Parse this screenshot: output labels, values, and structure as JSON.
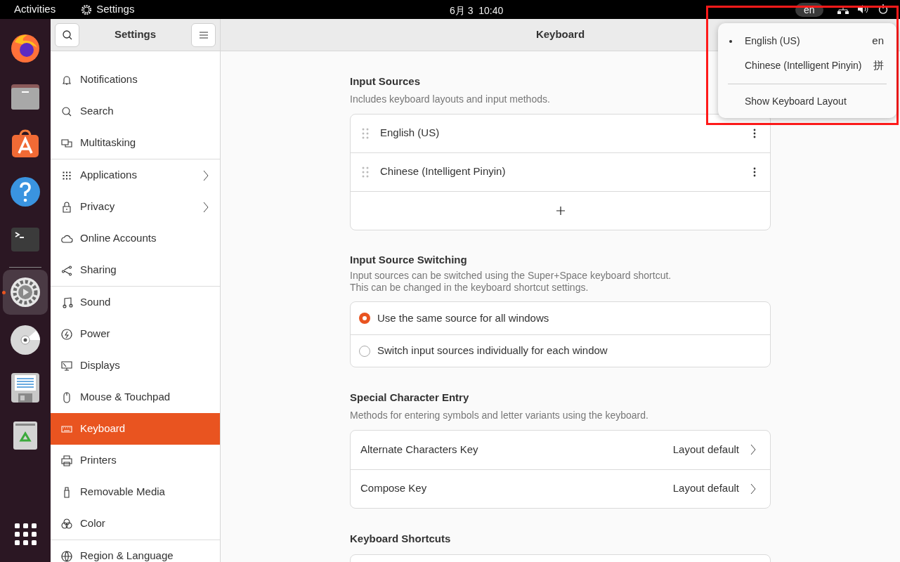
{
  "top_bar": {
    "activities": "Activities",
    "app_name": "Settings",
    "clock": "6月 3  10:40",
    "input_indicator": "en"
  },
  "dock": [
    {
      "selected": false,
      "running": false
    },
    {
      "selected": false,
      "running": false
    },
    {
      "selected": false,
      "running": false
    },
    {
      "selected": false,
      "running": false
    },
    {
      "selected": false,
      "running": false
    },
    {
      "selected": true,
      "running": true
    },
    {
      "selected": false,
      "running": false
    },
    {
      "selected": false,
      "running": false
    },
    {
      "selected": false,
      "running": false
    }
  ],
  "sidebar": {
    "title": "Settings",
    "groups": [
      {
        "items": [
          {
            "label": "Notifications",
            "selected": false,
            "has_arrow": false
          },
          {
            "label": "Search",
            "selected": false,
            "has_arrow": false
          },
          {
            "label": "Multitasking",
            "selected": false,
            "has_arrow": false
          }
        ]
      },
      {
        "items": [
          {
            "label": "Applications",
            "selected": false,
            "has_arrow": true
          },
          {
            "label": "Privacy",
            "selected": false,
            "has_arrow": true
          },
          {
            "label": "Online Accounts",
            "selected": false,
            "has_arrow": false
          },
          {
            "label": "Sharing",
            "selected": false,
            "has_arrow": false
          }
        ]
      },
      {
        "items": [
          {
            "label": "Sound",
            "selected": false,
            "has_arrow": false
          },
          {
            "label": "Power",
            "selected": false,
            "has_arrow": false
          },
          {
            "label": "Displays",
            "selected": false,
            "has_arrow": false
          },
          {
            "label": "Mouse & Touchpad",
            "selected": false,
            "has_arrow": false
          },
          {
            "label": "Keyboard",
            "selected": true,
            "has_arrow": false
          },
          {
            "label": "Printers",
            "selected": false,
            "has_arrow": false
          },
          {
            "label": "Removable Media",
            "selected": false,
            "has_arrow": false
          },
          {
            "label": "Color",
            "selected": false,
            "has_arrow": false
          }
        ]
      },
      {
        "items": [
          {
            "label": "Region & Language",
            "selected": false,
            "has_arrow": false
          }
        ]
      }
    ]
  },
  "content": {
    "title": "Keyboard",
    "input_sources": {
      "heading": "Input Sources",
      "description": "Includes keyboard layouts and input methods.",
      "sources": [
        {
          "name": "English (US)"
        },
        {
          "name": "Chinese (Intelligent Pinyin)"
        }
      ]
    },
    "switching": {
      "heading": "Input Source Switching",
      "description": [
        "Input sources can be switched using the Super+Space keyboard shortcut.",
        "This can be changed in the keyboard shortcut settings."
      ],
      "options": [
        {
          "label": "Use the same source for all windows",
          "selected": true
        },
        {
          "label": "Switch input sources individually for each window",
          "selected": false
        }
      ]
    },
    "special": {
      "heading": "Special Character Entry",
      "description": "Methods for entering symbols and letter variants using the keyboard.",
      "rows": [
        {
          "label": "Alternate Characters Key",
          "value": "Layout default"
        },
        {
          "label": "Compose Key",
          "value": "Layout default"
        }
      ]
    },
    "shortcuts": {
      "heading": "Keyboard Shortcuts"
    }
  },
  "input_menu": {
    "items": [
      {
        "label": "English (US)",
        "short": "en",
        "active": true
      },
      {
        "label": "Chinese (Intelligent Pinyin)",
        "short": "拼",
        "active": false
      }
    ],
    "action": "Show Keyboard Layout"
  }
}
